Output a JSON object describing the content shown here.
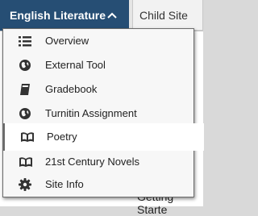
{
  "site_tab": {
    "label": "English Literature",
    "chevron": "chevron-up-icon"
  },
  "child_site": {
    "label": "Child Site"
  },
  "menu": {
    "items": [
      {
        "label": "Overview",
        "icon": "list-icon"
      },
      {
        "label": "External Tool",
        "icon": "globe-icon"
      },
      {
        "label": "Gradebook",
        "icon": "book-icon"
      },
      {
        "label": "Turnitin Assignment",
        "icon": "globe-icon"
      },
      {
        "label": "Poetry",
        "icon": "open-book-icon",
        "active": true
      },
      {
        "label": "21st Century Novels",
        "icon": "open-book-icon"
      },
      {
        "label": "Site Info",
        "icon": "gear-icon"
      }
    ]
  },
  "background": {
    "getting_started": "Getting Starte"
  },
  "colors": {
    "site_tab_bg": "#264e74",
    "menu_bg": "#f7f7f7",
    "active_bg": "#ffffff"
  }
}
